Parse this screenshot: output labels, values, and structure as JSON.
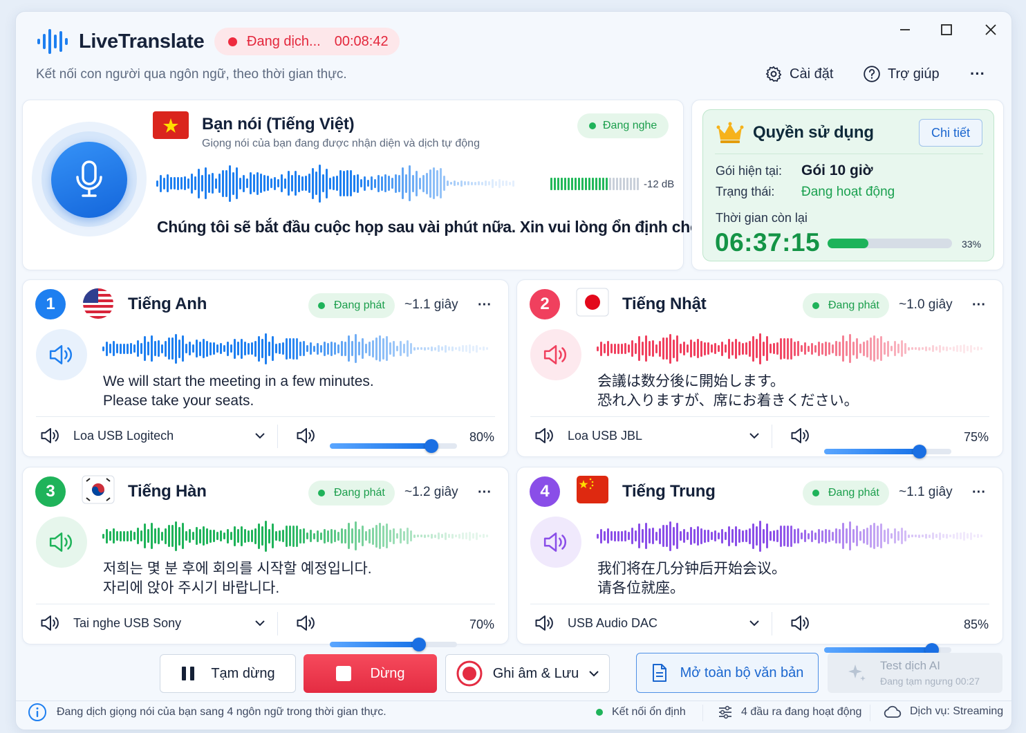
{
  "app": {
    "title": "LiveTranslate",
    "subtitle": "Kết nối con người qua ngôn ngữ, theo thời gian thực.",
    "status_text": "Đang dịch...",
    "timer": "00:08:42",
    "settings_label": "Cài đặt",
    "help_label": "Trợ giúp",
    "more_label": "···"
  },
  "source": {
    "title": "Bạn nói (Tiếng Việt)",
    "desc": "Giọng nói của bạn đang được nhận diện và dịch tự động",
    "listening": "Đang nghe",
    "db": "-12 dB",
    "level_fraction": 0.65,
    "transcript": "Chúng tôi sẽ bắt đầu cuộc họp sau vài phút nữa. Xin vui lòng ổn định chỗ ngồi."
  },
  "license": {
    "title": "Quyền sử dụng",
    "details_label": "Chi tiết",
    "plan_label": "Gói hiện tại:",
    "plan_value": "Gói 10 giờ",
    "status_label": "Trạng thái:",
    "status_value": "Đang hoạt động",
    "remaining_label": "Thời gian còn lại",
    "remaining_value": "06:37:15",
    "remaining_percent": "33%",
    "used_fraction": 0.33
  },
  "outputs": [
    {
      "num": "1",
      "lang": "Tiếng Anh",
      "status": "Đang phát",
      "latency": "~1.1 giây",
      "text1": "We will start the meeting in a few minutes.",
      "text2": "Please take your seats.",
      "device": "Loa USB Logitech",
      "volume_label": "80%",
      "volume": 0.8,
      "accent": "#1e7ff0",
      "icon_bg": "#e8f1fc"
    },
    {
      "num": "2",
      "lang": "Tiếng Nhật",
      "status": "Đang phát",
      "latency": "~1.0 giây",
      "text1": "会議は数分後に開始します。",
      "text2": "恐れ入りますが、席にお着きください。",
      "device": "Loa USB JBL",
      "volume_label": "75%",
      "volume": 0.75,
      "accent": "#f0405e",
      "icon_bg": "#fde9ee"
    },
    {
      "num": "3",
      "lang": "Tiếng Hàn",
      "status": "Đang phát",
      "latency": "~1.2 giây",
      "text1": "저희는 몇 분 후에 회의를 시작할 예정입니다.",
      "text2": "자리에 앉아 주시기 바랍니다.",
      "device": "Tai nghe USB Sony",
      "volume_label": "70%",
      "volume": 0.7,
      "accent": "#1fb35a",
      "icon_bg": "#e6f6ec"
    },
    {
      "num": "4",
      "lang": "Tiếng Trung",
      "status": "Đang phát",
      "latency": "~1.1 giây",
      "text1": "我们将在几分钟后开始会议。",
      "text2": "请各位就座。",
      "device": "USB Audio DAC",
      "volume_label": "85%",
      "volume": 0.85,
      "accent": "#8a4ee8",
      "icon_bg": "#f0e9fc"
    }
  ],
  "controls": {
    "pause": "Tạm dừng",
    "stop": "Dừng",
    "record": "Ghi âm & Lưu",
    "open_text": "Mở toàn bộ văn bản",
    "ai_title": "Test dịch AI",
    "ai_sub": "Đang tạm ngưng 00:27"
  },
  "statusbar": {
    "info": "Đang dịch giọng nói của bạn sang 4 ngôn ngữ trong thời gian thực.",
    "connection": "Kết nối ổn định",
    "outputs": "4 đầu ra đang hoạt động",
    "service": "Dịch vụ: Streaming"
  }
}
